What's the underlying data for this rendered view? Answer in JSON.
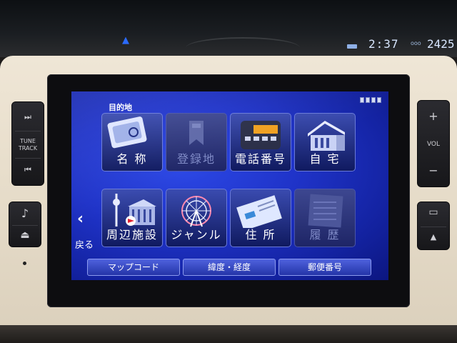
{
  "dashboard": {
    "clock": "2:37",
    "odometer": "2425",
    "odo_icon_glyph": "ooo"
  },
  "screen": {
    "title": "目的地",
    "tiles": [
      {
        "label": "名 称",
        "enabled": true,
        "icon": "keyboard-icon"
      },
      {
        "label": "登録地",
        "enabled": false,
        "icon": "bookmark-icon"
      },
      {
        "label": "電話番号",
        "enabled": true,
        "icon": "phone-icon"
      },
      {
        "label": "自 宅",
        "enabled": true,
        "icon": "house-icon"
      },
      {
        "label": "周辺施設",
        "enabled": true,
        "icon": "landmark-icon"
      },
      {
        "label": "ジャンル",
        "enabled": true,
        "icon": "ferris-wheel-icon"
      },
      {
        "label": "住 所",
        "enabled": true,
        "icon": "address-card-icon"
      },
      {
        "label": "履 歴",
        "enabled": false,
        "icon": "history-list-icon"
      }
    ],
    "back": {
      "arrow": "‹",
      "label": "戻る"
    },
    "bottom_buttons": [
      {
        "label": "マップコード"
      },
      {
        "label": "緯度・経度"
      },
      {
        "label": "郵便番号"
      }
    ]
  },
  "hardware": {
    "left": {
      "next_track_glyph": "⏭",
      "tune_track_label": "TUNE\nTRACK",
      "prev_track_glyph": "⏮",
      "music_glyph": "♪",
      "eject_glyph": "⏏"
    },
    "right": {
      "vol_up_glyph": "+",
      "vol_label": "VOL",
      "vol_down_glyph": "−",
      "screen_mode_glyph": "▭",
      "nav_glyph": "▲"
    }
  },
  "colors": {
    "screen_blue": "#1f33c8",
    "bezel_beige": "#e6dcc9",
    "button_blue": "#3445c4"
  }
}
